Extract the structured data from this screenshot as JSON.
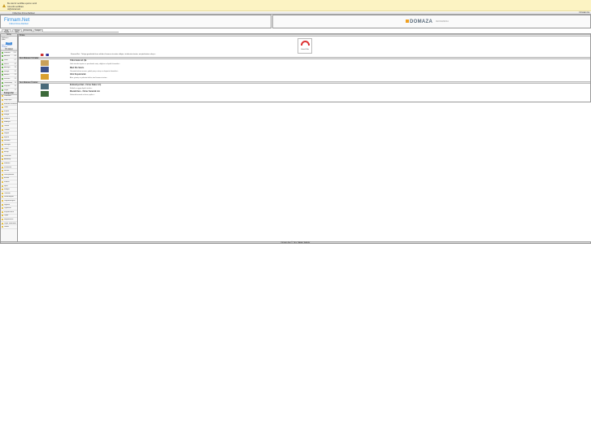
{
  "notification": {
    "title": "Bu site bir sertifika uyarısı verdi",
    "text": "Güvenlik sertifikası doğrulanamadı",
    "icon": "warning-icon"
  },
  "titlebar": {
    "title": "Yolbul.Net Firma Rehberi",
    "right": "Firmalar Ara"
  },
  "header": {
    "logo": "Firmam.Net",
    "logo_sub": "Yolbul Firma Rehberi",
    "ad_logo": "DOMAZA",
    "ad_sub": "DEFNEMENKA"
  },
  "nav": [
    "Ana Sayfa",
    "Firma Ekle",
    "Firma Ara",
    "İletişim"
  ],
  "sidebar": {
    "login_title": "Giriş",
    "login_items": [
      "Kullanıcı",
      "Şifre"
    ],
    "login_button": "Giriş",
    "login_link": "Üye Ol / Şifremi Unuttum",
    "lists_title": "İl Listesi",
    "lists": [
      {
        "l": "İstanbul",
        "c": "120"
      },
      {
        "l": "Ankara",
        "c": "84"
      },
      {
        "l": "İzmir",
        "c": "67"
      },
      {
        "l": "Bursa",
        "c": "45"
      },
      {
        "l": "Antalya",
        "c": "39"
      },
      {
        "l": "Konya",
        "c": "31"
      },
      {
        "l": "Adana",
        "c": "28"
      },
      {
        "l": "Kocaeli",
        "c": "24"
      },
      {
        "l": "Gaziantep",
        "c": "19"
      },
      {
        "l": "Kayseri",
        "c": "15"
      },
      {
        "l": "Diğer",
        "c": "12"
      }
    ],
    "cat_title": "Kategoriler",
    "categories": [
      "Otomotiv",
      "Bilgisayar",
      "Elektrik Elektronik",
      "Gıda",
      "İnşaat",
      "Kimya",
      "Makine",
      "Mobilya",
      "Tekstil",
      "Turizm",
      "Sağlık",
      "Eğitim",
      "Reklam",
      "Nakliyat",
      "Tarım",
      "Enerji",
      "Güvenlik",
      "Ambalaj",
      "Matbaa",
      "Kozmetik",
      "Hukuk",
      "Danışmanlık",
      "Emlak",
      "Finans",
      "Spor",
      "Medya",
      "Temizlik",
      "Dekorasyon",
      "Organizasyon",
      "Sigorta",
      "Oyuncak",
      "Kuyumculuk",
      "Optik",
      "Hayvancılık",
      "Diğer Hizmetler",
      "Genel"
    ]
  },
  "main": {
    "top_label": "Firma",
    "top_text": "Firmam.Net - Türkiye genelinde firma rehberi; firmanızı ücretsiz ekleyin, ürünlerinizi tanıtın, müşterilerinize ulaşın...",
    "badge": "Güvenli Site",
    "sec1": "Son Eklenen Firmalar",
    "firms": [
      {
        "t": "Yıldız Gıda Ltd. Şti.",
        "d": "Gıda ürünleri toptan ve perakende satış, dağıtım ve lojistik hizmetleri..."
      },
      {
        "t": "Mavi Oto Servis",
        "d": "Otomotiv bakım onarım, yedek parça satışı ve ekspertiz hizmetleri..."
      },
      {
        "t": "Altın Kuyumculuk",
        "d": "Altın, gümüş ve pırlanta takılar, özel tasarım üretim..."
      }
    ],
    "sec2": "Son Eklenen Ürünler",
    "products": [
      {
        "t": "Endüstriyel Halı - Firma: Dekor A.Ş.",
        "d": "Kaliteli ve uygun fiyatlı ürünler..."
      },
      {
        "t": "Mozaik Karo - Firma: Seramik Ltd.",
        "d": "Dekoratif mozaik ve karo çeşitleri..."
      }
    ]
  },
  "footer": "Firmam.Net © Tüm Hakları Saklıdır"
}
